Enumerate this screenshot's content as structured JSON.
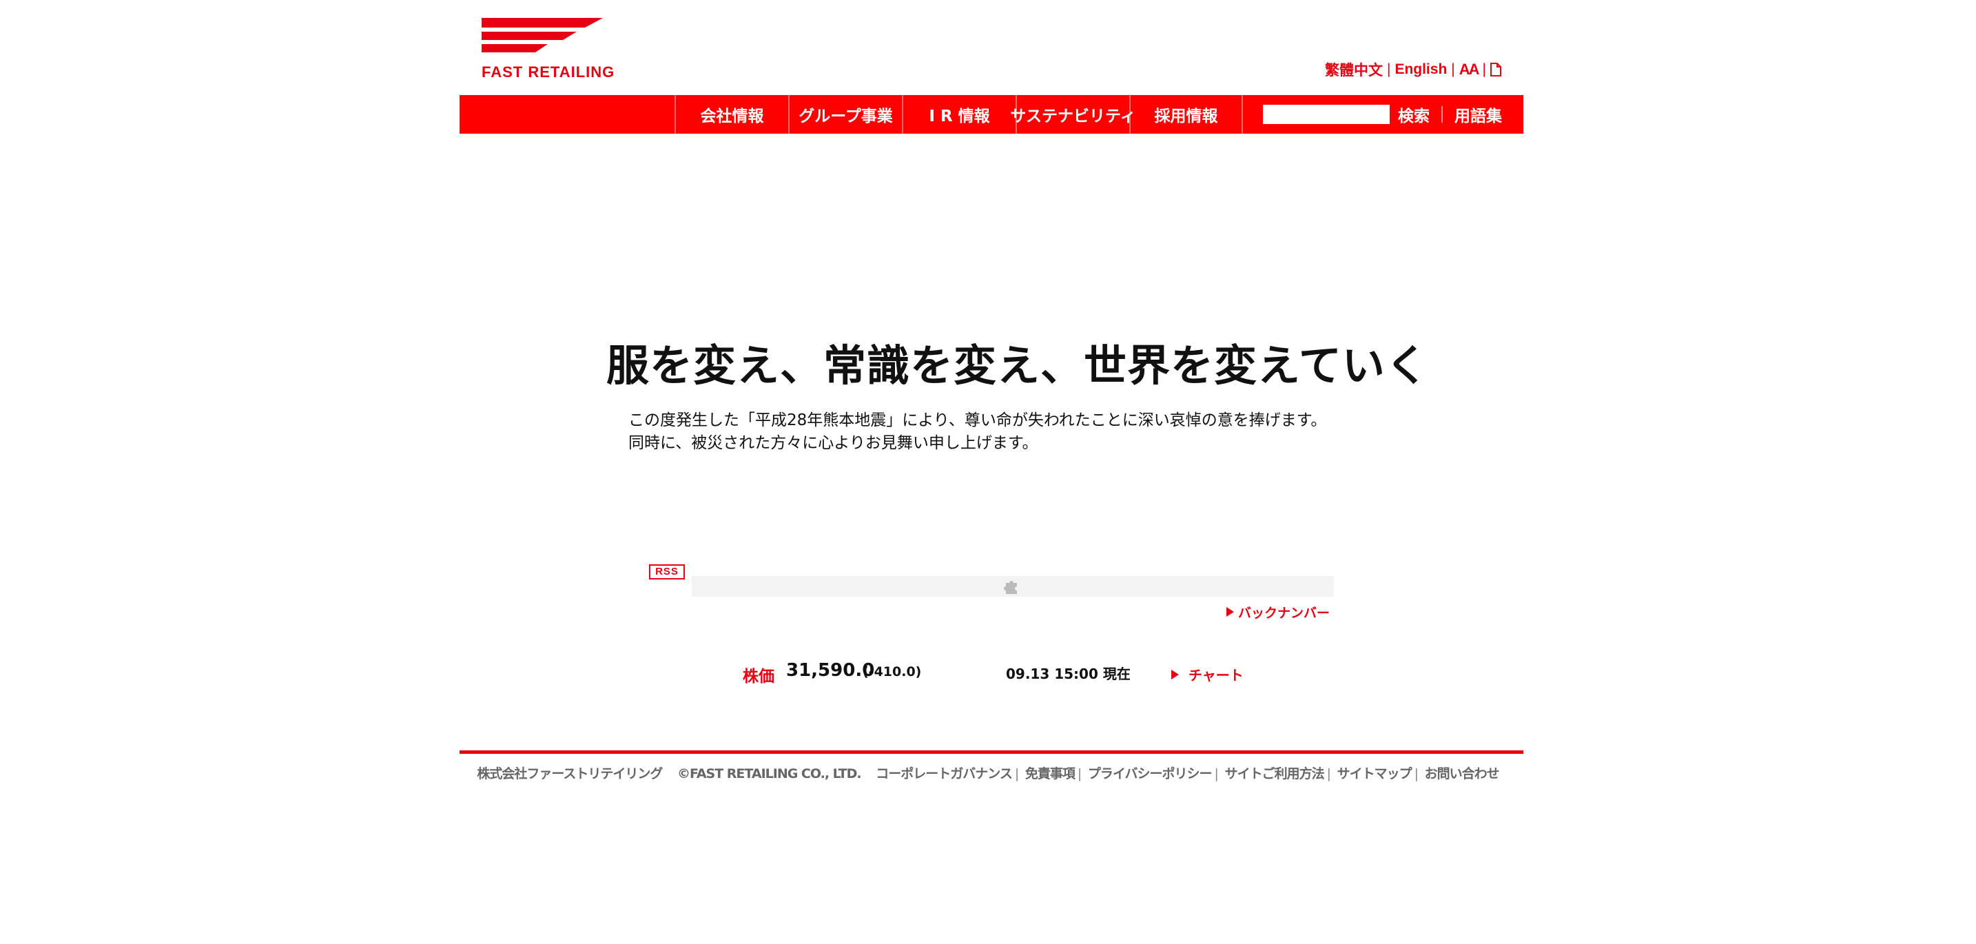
{
  "header": {
    "logo_text": "FAST RETAILING",
    "utility": {
      "chinese": "繁體中文",
      "english": "English",
      "font_size_icon": "AA",
      "doc_icon": "document-icon"
    }
  },
  "nav": {
    "items": [
      {
        "label": "会社情報"
      },
      {
        "label": "グループ事業"
      },
      {
        "label": "I R 情報"
      },
      {
        "label": "サステナビリティ"
      },
      {
        "label": "採用情報"
      }
    ],
    "search": {
      "value": "",
      "button_label": "検索"
    },
    "glossary_label": "用語集"
  },
  "hero": {
    "title": "服を変え、常識を変え、世界を変えていく",
    "condolence": [
      "この度発生した「平成28年熊本地震」により、尊い命が失われたことに深い哀悼の意を捧げます。",
      "同時に、被災された方々に心よりお見舞い申し上げます。"
    ]
  },
  "news": {
    "rss_label": "RSS",
    "plugin_icon": "plugin-icon",
    "backnumber_label": "バックナンバー"
  },
  "stock": {
    "label": "株価",
    "price": "31,590.0",
    "change": "(-410.0)",
    "time": "09.13 15:00 現在",
    "chart_label": "チャート"
  },
  "footer": {
    "company": "株式会社ファーストリテイリング",
    "copyright": "©FAST RETAILING CO., LTD.",
    "links": [
      {
        "label": "コーポレートガバナンス"
      },
      {
        "label": "免責事項"
      },
      {
        "label": "プライバシーポリシー"
      },
      {
        "label": "サイトご利用方法"
      },
      {
        "label": "サイトマップ"
      },
      {
        "label": "お問い合わせ"
      }
    ]
  },
  "colors": {
    "brand_red": "#e60012",
    "nav_red": "#ff0000"
  }
}
